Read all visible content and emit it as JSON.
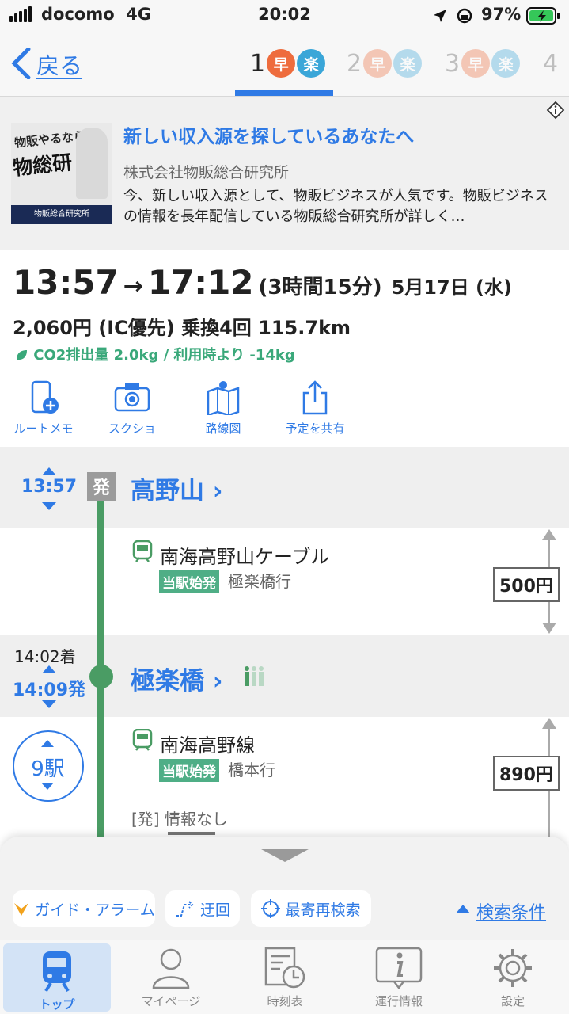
{
  "status_bar": {
    "carrier": "docomo",
    "network": "4G",
    "time": "20:02",
    "battery": "97%"
  },
  "nav": {
    "back_label": "戻る",
    "route_tabs": [
      {
        "number": "1",
        "badge_fast": "早",
        "badge_easy": "楽"
      },
      {
        "number": "2",
        "badge_fast": "早",
        "badge_easy": "楽"
      },
      {
        "number": "3",
        "badge_fast": "早",
        "badge_easy": "楽"
      },
      {
        "number": "4"
      }
    ]
  },
  "ad": {
    "title": "新しい収入源を探しているあなたへ",
    "company": "株式会社物販総合研究所",
    "description": "今、新しい収入源として、物販ビジネスが人気です。物販ビジネスの情報を長年配信している物販総合研究所が詳しく…",
    "image_text_1": "物販やるなら",
    "image_text_2": "物総研",
    "image_text_3": "物販総合研究所"
  },
  "summary": {
    "depart": "13:57",
    "arrow": "→",
    "arrive": "17:12",
    "duration": "(3時間15分)",
    "date": "5月17日 (水)",
    "fare_line": "2,060円 (IC優先) 乗換4回 115.7km",
    "co2_line": "CO2排出量 2.0kg / 利用時より -14kg"
  },
  "tools": [
    {
      "label": "ルートメモ",
      "icon": "phone-plus-icon"
    },
    {
      "label": "スクショ",
      "icon": "camera-icon"
    },
    {
      "label": "路線図",
      "icon": "map-icon"
    },
    {
      "label": "予定を共有",
      "icon": "share-icon"
    }
  ],
  "timeline": {
    "stop1": {
      "time": "13:57",
      "tag": "発",
      "name": "高野山 ›"
    },
    "leg1": {
      "train": "南海高野山ケーブル",
      "origin_tag": "当駅始発",
      "destination": "極楽橋行",
      "fare": "500円"
    },
    "stop2": {
      "arrive": "14:02着",
      "depart": "14:09発",
      "name": "極楽橋 ›"
    },
    "leg2": {
      "stations": "9駅",
      "train": "南海高野線",
      "origin_tag": "当駅始発",
      "destination": "橋本行",
      "fare": "890円",
      "info": "[発] 情報なし"
    }
  },
  "sheet": {
    "guide_alarm": "ガイド・アラーム",
    "detour": "迂回",
    "nearest": "最寄再検索",
    "conditions": "検索条件"
  },
  "tabbar": [
    {
      "label": "トップ",
      "icon": "train-icon"
    },
    {
      "label": "マイページ",
      "icon": "person-icon"
    },
    {
      "label": "時刻表",
      "icon": "timetable-icon"
    },
    {
      "label": "運行情報",
      "icon": "info-icon"
    },
    {
      "label": "設定",
      "icon": "gear-icon"
    }
  ],
  "colors": {
    "accent": "#2f7ae5",
    "route_green": "#4a9c64",
    "fast_badge": "#ee6c3d",
    "easy_badge": "#3aa6d8"
  }
}
